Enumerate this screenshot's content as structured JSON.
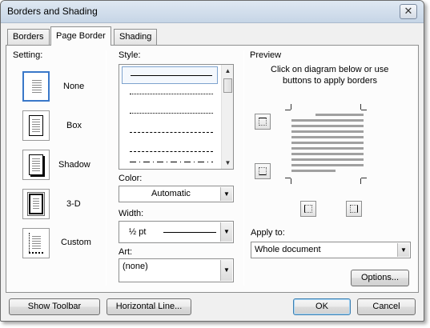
{
  "window": {
    "title": "Borders and Shading",
    "close_glyph": "✕"
  },
  "tabs": [
    {
      "label": "Borders",
      "active": false
    },
    {
      "label": "Page Border",
      "active": true
    },
    {
      "label": "Shading",
      "active": false
    }
  ],
  "setting": {
    "heading": "Setting:",
    "options": [
      "None",
      "Box",
      "Shadow",
      "3-D",
      "Custom"
    ],
    "selected": "None"
  },
  "style": {
    "heading": "Style:",
    "rows": [
      "solid",
      "dotted-fine",
      "dotted",
      "dashed-short",
      "dashed",
      "dash-dot"
    ]
  },
  "color": {
    "heading": "Color:",
    "value": "Automatic"
  },
  "width": {
    "heading": "Width:",
    "value": "½ pt"
  },
  "art": {
    "heading": "Art:",
    "value": "(none)"
  },
  "preview": {
    "heading": "Preview",
    "instructions_line1": "Click on diagram below or use",
    "instructions_line2": "buttons to apply borders"
  },
  "apply_to": {
    "heading": "Apply to:",
    "value": "Whole document"
  },
  "buttons": {
    "options": "Options...",
    "show_toolbar": "Show Toolbar",
    "horizontal_line": "Horizontal Line...",
    "ok": "OK",
    "cancel": "Cancel"
  },
  "icons": {
    "close": "close-icon",
    "dropdown": "▼",
    "scroll_up": "▲",
    "scroll_down": "▼"
  }
}
